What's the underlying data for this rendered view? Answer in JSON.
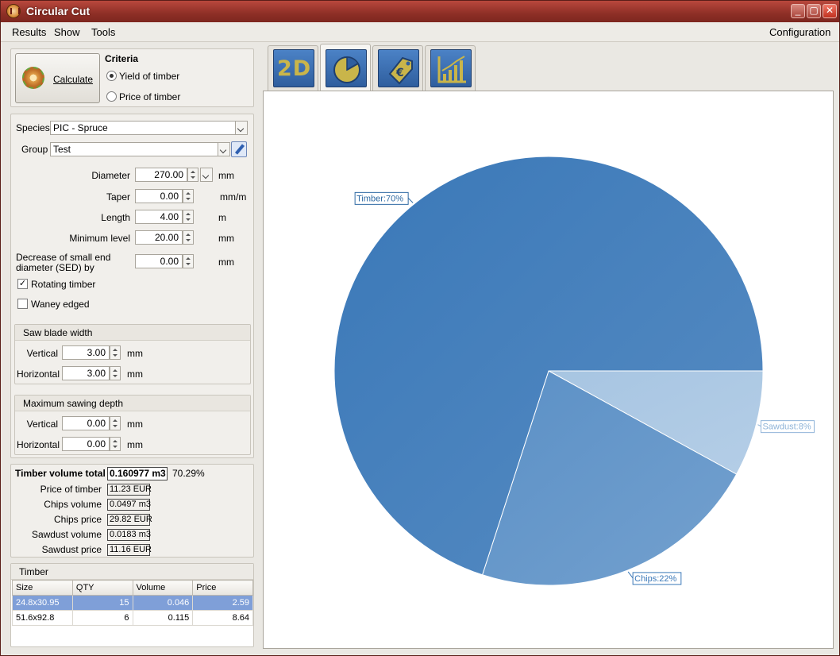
{
  "window": {
    "title": "Circular Cut"
  },
  "menu": {
    "items": [
      "Results",
      "Show",
      "Tools"
    ],
    "right": "Configuration"
  },
  "calc": {
    "button_label": "Calculate"
  },
  "criteria": {
    "title": "Criteria",
    "options": [
      "Yield of timber",
      "Price of timber"
    ],
    "selected": "Yield of timber"
  },
  "form": {
    "species_label": "Species",
    "species_value": "PIC - Spruce",
    "group_label": "Group",
    "group_value": "Test",
    "diameter_label": "Diameter",
    "diameter_value": "270.00",
    "diameter_unit": "mm",
    "taper_label": "Taper",
    "taper_value": "0.00",
    "taper_unit": "mm/m",
    "length_label": "Length",
    "length_value": "4.00",
    "length_unit": "m",
    "minlevel_label": "Minimum level",
    "minlevel_value": "20.00",
    "minlevel_unit": "mm",
    "sed_label_1": "Decrease of small end",
    "sed_label_2": "diameter (SED) by",
    "sed_value": "0.00",
    "sed_unit": "mm",
    "rotating_label": "Rotating timber",
    "rotating_checked": true,
    "waney_label": "Waney edged",
    "waney_checked": false
  },
  "saw_blade": {
    "title": "Saw blade width",
    "vertical_label": "Vertical",
    "vertical_value": "3.00",
    "vertical_unit": "mm",
    "horizontal_label": "Horizontal",
    "horizontal_value": "3.00",
    "horizontal_unit": "mm"
  },
  "max_depth": {
    "title": "Maximum sawing depth",
    "vertical_label": "Vertical",
    "vertical_value": "0.00",
    "vertical_unit": "mm",
    "horizontal_label": "Horizontal",
    "horizontal_value": "0.00",
    "horizontal_unit": "mm"
  },
  "results": {
    "total_label": "Timber volume total",
    "total_value": "0.160977 m3",
    "total_percent": "70.29%",
    "price_label": "Price of timber",
    "price_value": "11.23 EUR",
    "chips_volume_label": "Chips volume",
    "chips_volume_value": "0.0497 m3",
    "chips_price_label": "Chips price",
    "chips_price_value": "29.82 EUR",
    "sawdust_volume_label": "Sawdust volume",
    "sawdust_volume_value": "0.0183 m3",
    "sawdust_price_label": "Sawdust price",
    "sawdust_price_value": "11.16 EUR"
  },
  "timber_table": {
    "title": "Timber",
    "headers": [
      "Size",
      "QTY",
      "Volume",
      "Price"
    ],
    "rows": [
      [
        "24.8x30.95",
        "15",
        "0.046",
        "2.59"
      ],
      [
        "51.6x92.8",
        "6",
        "0.115",
        "8.64"
      ]
    ],
    "selected_row": 0
  },
  "tabs": [
    {
      "name": "tab-2d",
      "label": "2D",
      "icon": "2d-icon"
    },
    {
      "name": "tab-pie",
      "label": "",
      "icon": "pie-chart-icon"
    },
    {
      "name": "tab-price",
      "label": "",
      "icon": "euro-tag-icon"
    },
    {
      "name": "tab-stats",
      "label": "",
      "icon": "bar-chart-icon"
    }
  ],
  "active_tab": 1,
  "colors": {
    "titlebar": "#9c3429",
    "timber": "#3a78b8",
    "chips": "#5b90c6",
    "sawdust": "#a7c5e2",
    "tab_face": "#3e72b8",
    "tab_glyph": "#c9b54a"
  },
  "chart_data": {
    "type": "pie",
    "categories": [
      "Timber",
      "Chips",
      "Sawdust"
    ],
    "values": [
      70,
      22,
      8
    ],
    "labels": [
      "Timber:70%",
      "Chips:22%",
      "Sawdust:8%"
    ],
    "start_angle_deg": 0,
    "direction": "clockwise",
    "legend": "none"
  }
}
